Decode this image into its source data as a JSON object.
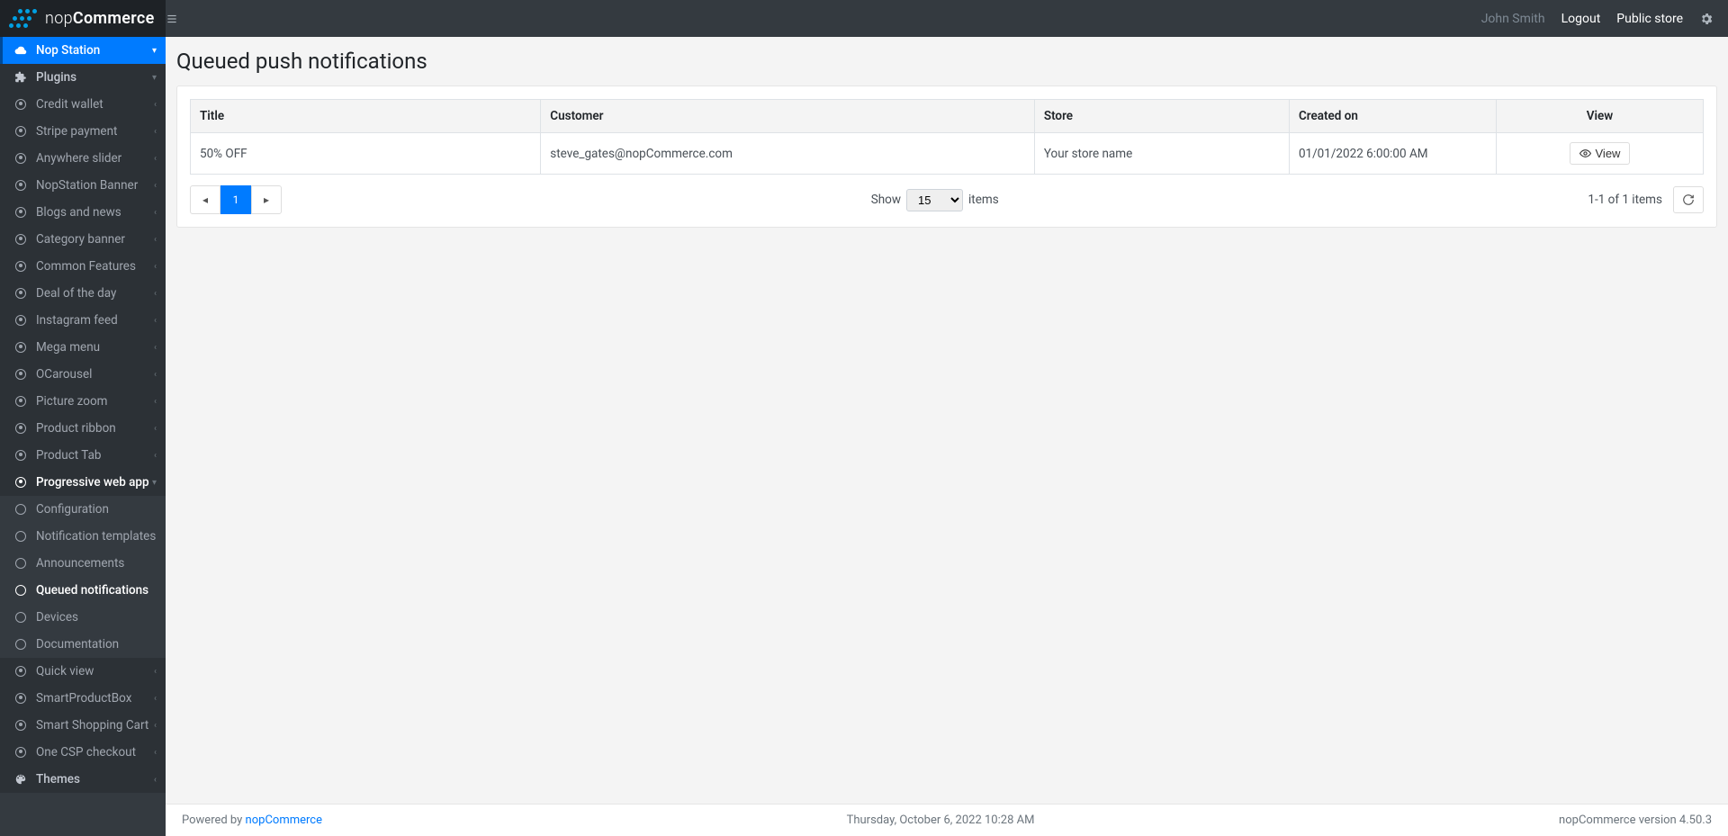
{
  "brand": {
    "name_light": "nop",
    "name_bold": "Commerce"
  },
  "topbar": {
    "username": "John Smith",
    "logout": "Logout",
    "public_store": "Public store"
  },
  "sidebar": {
    "nop_station": "Nop Station",
    "plugins": "Plugins",
    "sub_items": [
      "Credit wallet",
      "Stripe payment",
      "Anywhere slider",
      "NopStation Banner",
      "Blogs and news",
      "Category banner",
      "Common Features",
      "Deal of the day",
      "Instagram feed",
      "Mega menu",
      "OCarousel",
      "Picture zoom",
      "Product ribbon",
      "Product Tab"
    ],
    "pwa": "Progressive web app",
    "pwa_children": [
      {
        "label": "Configuration",
        "active": false
      },
      {
        "label": "Notification templates",
        "active": false
      },
      {
        "label": "Announcements",
        "active": false
      },
      {
        "label": "Queued notifications",
        "active": true
      },
      {
        "label": "Devices",
        "active": false
      },
      {
        "label": "Documentation",
        "active": false
      }
    ],
    "after_items": [
      "Quick view",
      "SmartProductBox",
      "Smart Shopping Cart",
      "One CSP checkout"
    ],
    "themes": "Themes"
  },
  "page": {
    "title": "Queued push notifications",
    "columns": {
      "title": "Title",
      "customer": "Customer",
      "store": "Store",
      "created": "Created on",
      "view": "View"
    },
    "rows": [
      {
        "title": "50% OFF",
        "customer": "steve_gates@nopCommerce.com",
        "store": "Your store name",
        "created": "01/01/2022 6:00:00 AM"
      }
    ],
    "view_btn": "View",
    "pager": {
      "current": "1"
    },
    "show_label_before": "Show",
    "show_label_after": "items",
    "page_size": "15",
    "summary": "1-1 of 1 items"
  },
  "footer": {
    "powered_prefix": "Powered by ",
    "powered_link": "nopCommerce",
    "date": "Thursday, October 6, 2022 10:28 AM",
    "version": "nopCommerce version 4.50.3"
  }
}
